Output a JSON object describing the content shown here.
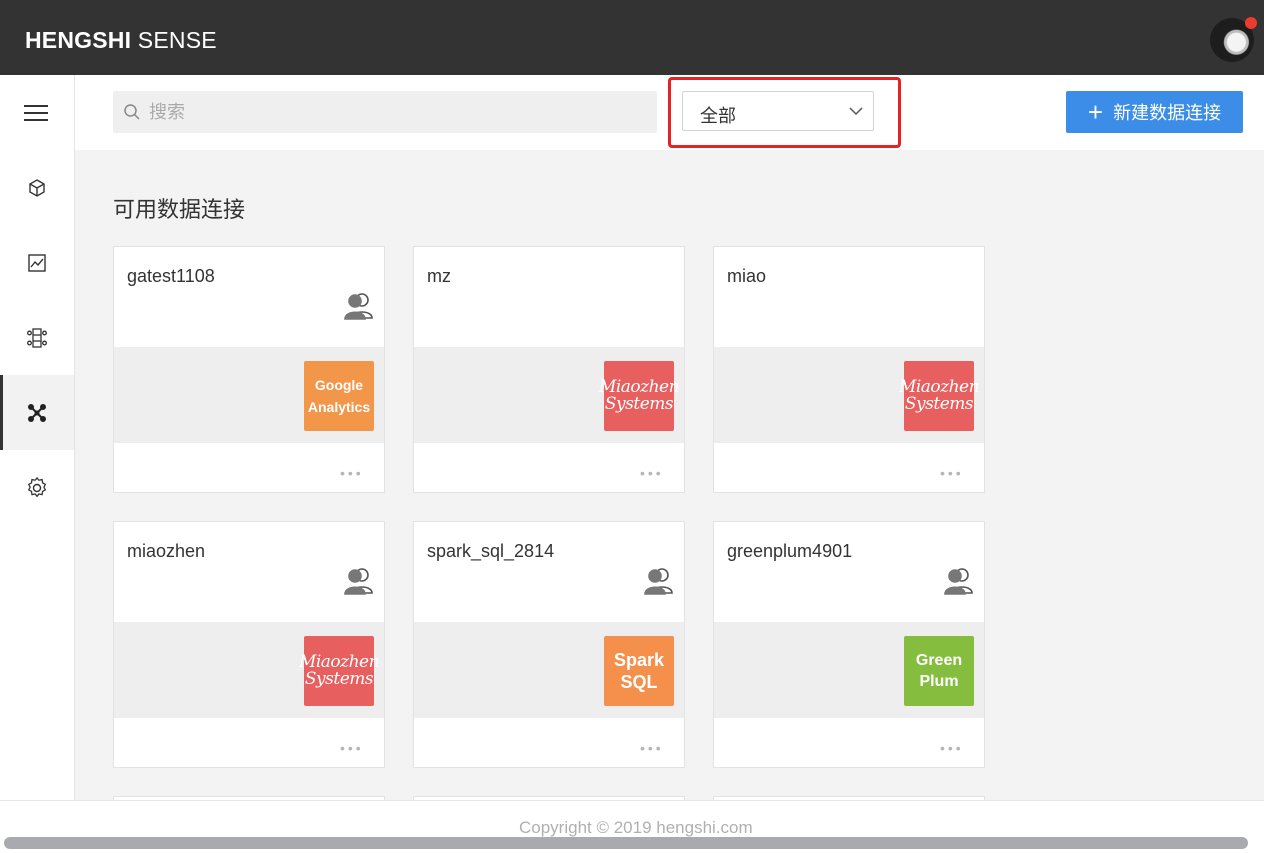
{
  "app": {
    "brand_bold": "HENGSHI",
    "brand_light": "SENSE"
  },
  "sidebar": {
    "items": [
      {
        "id": "menu",
        "icon": "menu-icon"
      },
      {
        "id": "data-models",
        "icon": "cube-icon"
      },
      {
        "id": "dashboards",
        "icon": "chart-icon"
      },
      {
        "id": "datasets",
        "icon": "dataset-icon"
      },
      {
        "id": "connections",
        "icon": "network-icon",
        "active": true
      },
      {
        "id": "settings",
        "icon": "gear-icon"
      }
    ]
  },
  "toolbar": {
    "search_placeholder": "搜索",
    "filter_value": "全部",
    "new_button_label": "新建数据连接"
  },
  "section": {
    "title": "可用数据连接"
  },
  "cards": [
    {
      "name": "gatest1108",
      "shared": true,
      "logo": "ga",
      "logo_lines": [
        "Google",
        "Analytics"
      ]
    },
    {
      "name": "mz",
      "shared": false,
      "logo": "mz",
      "logo_lines": [
        "Miaozhen",
        "Systems"
      ]
    },
    {
      "name": "miao",
      "shared": false,
      "logo": "mz",
      "logo_lines": [
        "Miaozhen",
        "Systems"
      ]
    },
    {
      "name": "miaozhen",
      "shared": true,
      "logo": "mz",
      "logo_lines": [
        "Miaozhen",
        "Systems"
      ]
    },
    {
      "name": "spark_sql_2814",
      "shared": true,
      "logo": "spark",
      "logo_lines": [
        "Spark",
        "SQL"
      ]
    },
    {
      "name": "greenplum4901",
      "shared": true,
      "logo": "green",
      "logo_lines": [
        "Green",
        "Plum"
      ]
    }
  ],
  "card_more_label": "•••",
  "footer": {
    "copyright": "Copyright © 2019 hengshi.com"
  },
  "colors": {
    "topbar": "#333333",
    "primary": "#3b8de7",
    "highlight": "#e62222"
  }
}
